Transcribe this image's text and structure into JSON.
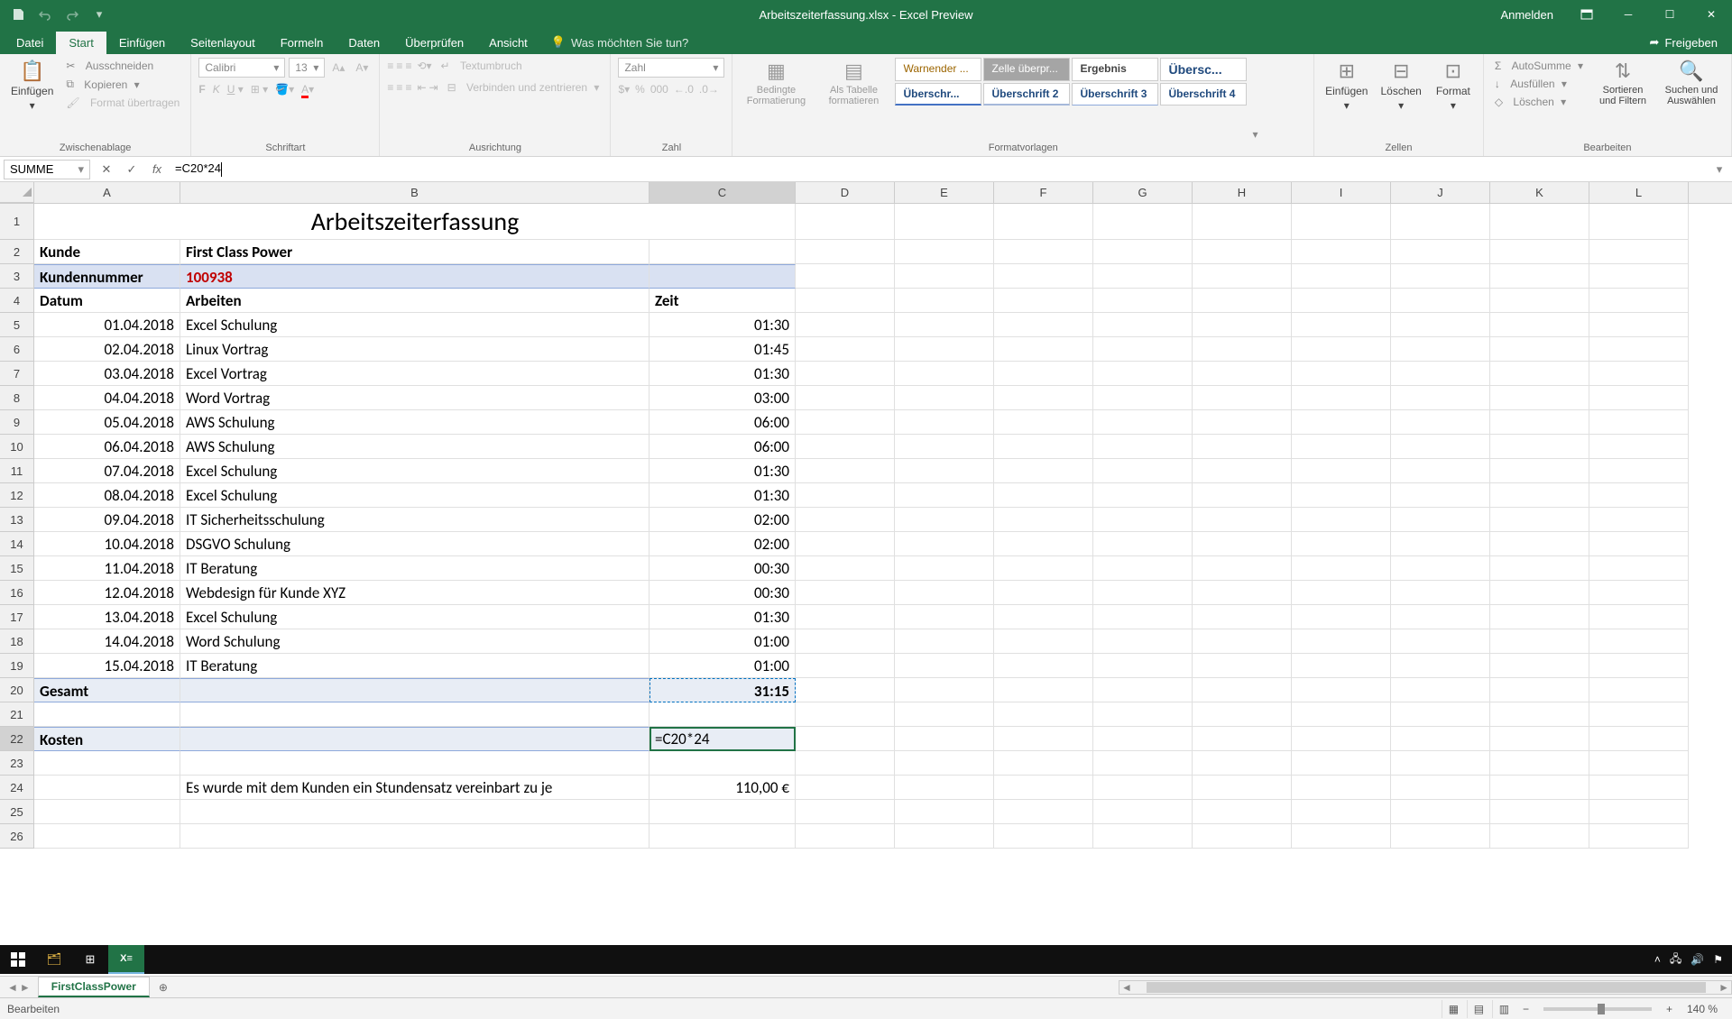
{
  "window": {
    "title": "Arbeitszeiterfassung.xlsx - Excel Preview",
    "signin": "Anmelden"
  },
  "ribbon_tabs": {
    "file": "Datei",
    "home": "Start",
    "insert": "Einfügen",
    "layout": "Seitenlayout",
    "formulas": "Formeln",
    "data": "Daten",
    "review": "Überprüfen",
    "view": "Ansicht",
    "tellme": "Was möchten Sie tun?",
    "share": "Freigeben"
  },
  "ribbon": {
    "paste": "Einfügen",
    "cut": "Ausschneiden",
    "copy": "Kopieren",
    "formatpainter": "Format übertragen",
    "clipboard": "Zwischenablage",
    "font_name": "Calibri",
    "font_size": "13",
    "font_group": "Schriftart",
    "wrap": "Textumbruch",
    "merge": "Verbinden und zentrieren",
    "align_group": "Ausrichtung",
    "numfmt": "Zahl",
    "num_group": "Zahl",
    "condfmt": "Bedingte Formatierung",
    "table": "Als Tabelle formatieren",
    "style_warn": "Warnender ...",
    "style_check": "Zelle überpr...",
    "style_result": "Ergebnis",
    "style_heading": "Übersc...",
    "style_h1": "Überschr...",
    "style_h2": "Überschrift 2",
    "style_h3": "Überschrift 3",
    "style_h4": "Überschrift 4",
    "styles_group": "Formatvorlagen",
    "insert_c": "Einfügen",
    "delete_c": "Löschen",
    "format_c": "Format",
    "cells_group": "Zellen",
    "autosum": "AutoSumme",
    "fill": "Ausfüllen",
    "clear": "Löschen",
    "sort": "Sortieren und Filtern",
    "find": "Suchen und Auswählen",
    "editing_group": "Bearbeiten"
  },
  "formula": {
    "namebox": "SUMME",
    "content": "=C20*24"
  },
  "columns": [
    "A",
    "B",
    "C",
    "D",
    "E",
    "F",
    "G",
    "H",
    "I",
    "J",
    "K",
    "L"
  ],
  "sheet": {
    "title": "Arbeitszeiterfassung",
    "kunde_label": "Kunde",
    "kunde_val": "First Class Power",
    "knr_label": "Kundennummer",
    "knr_val": "100938",
    "h_datum": "Datum",
    "h_arbeiten": "Arbeiten",
    "h_zeit": "Zeit",
    "rows": [
      {
        "d": "01.04.2018",
        "a": "Excel Schulung",
        "z": "01:30"
      },
      {
        "d": "02.04.2018",
        "a": "Linux Vortrag",
        "z": "01:45"
      },
      {
        "d": "03.04.2018",
        "a": "Excel Vortrag",
        "z": "01:30"
      },
      {
        "d": "04.04.2018",
        "a": "Word Vortrag",
        "z": "03:00"
      },
      {
        "d": "05.04.2018",
        "a": "AWS Schulung",
        "z": "06:00"
      },
      {
        "d": "06.04.2018",
        "a": "AWS Schulung",
        "z": "06:00"
      },
      {
        "d": "07.04.2018",
        "a": "Excel Schulung",
        "z": "01:30"
      },
      {
        "d": "08.04.2018",
        "a": "Excel Schulung",
        "z": "01:30"
      },
      {
        "d": "09.04.2018",
        "a": "IT Sicherheitsschulung",
        "z": "02:00"
      },
      {
        "d": "10.04.2018",
        "a": "DSGVO Schulung",
        "z": "02:00"
      },
      {
        "d": "11.04.2018",
        "a": "IT Beratung",
        "z": "00:30"
      },
      {
        "d": "12.04.2018",
        "a": "Webdesign für Kunde XYZ",
        "z": "00:30"
      },
      {
        "d": "13.04.2018",
        "a": "Excel Schulung",
        "z": "01:30"
      },
      {
        "d": "14.04.2018",
        "a": "Word Schulung",
        "z": "01:00"
      },
      {
        "d": "15.04.2018",
        "a": "IT Beratung",
        "z": "01:00"
      }
    ],
    "gesamt_label": "Gesamt",
    "gesamt_val": "31:15",
    "kosten_label": "Kosten",
    "kosten_formula": "=C20*24",
    "note": "Es wurde mit dem Kunden ein Stundensatz vereinbart zu je",
    "rate": "110,00 €"
  },
  "tabs": {
    "sheet1": "FirstClassPower"
  },
  "status": {
    "mode": "Bearbeiten",
    "zoom": "140 %"
  },
  "taskbar": {
    "time": ""
  }
}
